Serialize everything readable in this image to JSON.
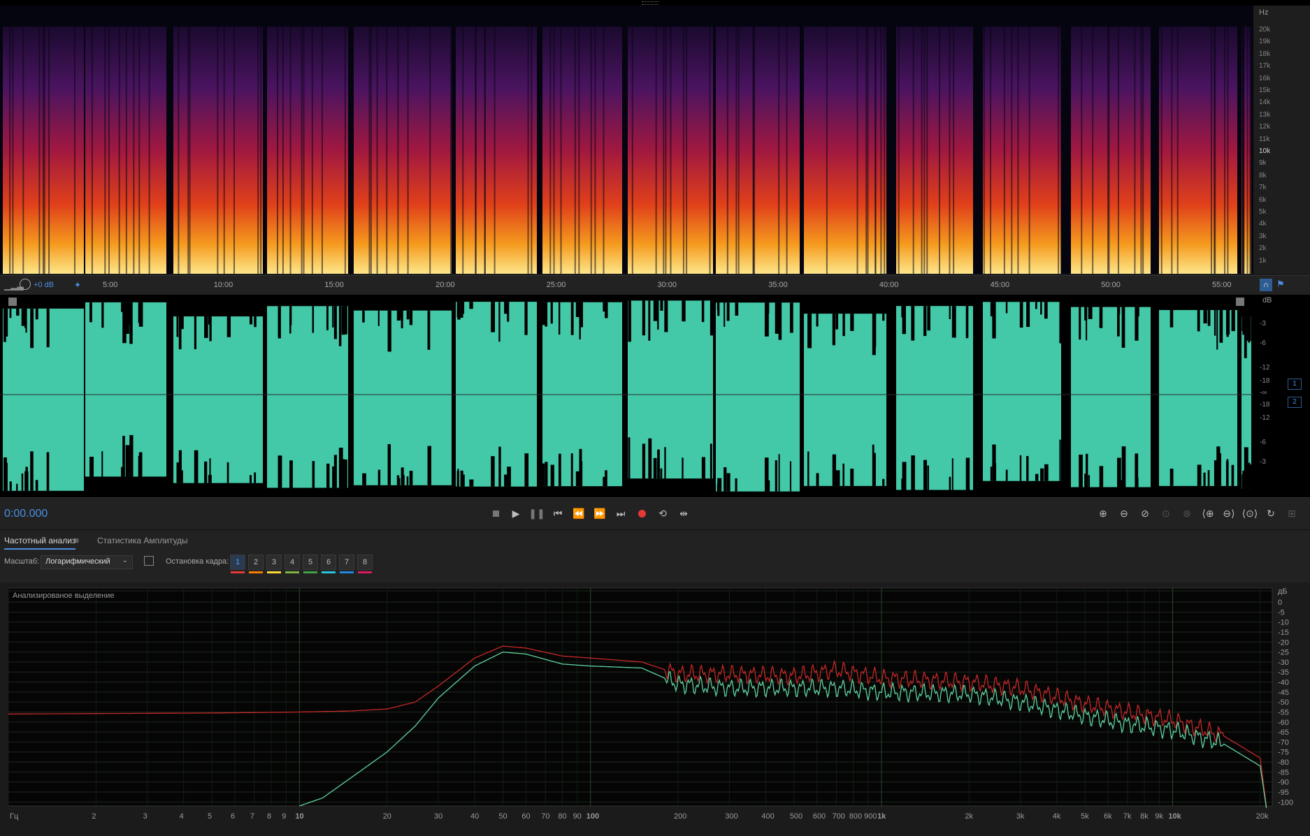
{
  "spectrogram": {
    "unit": "Hz",
    "ticks": [
      "20k",
      "19k",
      "18k",
      "17k",
      "16k",
      "15k",
      "14k",
      "13k",
      "12k",
      "11k",
      "10k",
      "9k",
      "8k",
      "7k",
      "6k",
      "5k",
      "4k",
      "3k",
      "2k",
      "1k"
    ]
  },
  "timeline": {
    "gain": "+0 dB",
    "labels": [
      "5:00",
      "10:00",
      "15:00",
      "20:00",
      "25:00",
      "30:00",
      "35:00",
      "40:00",
      "45:00",
      "50:00",
      "55:00"
    ]
  },
  "waveform": {
    "unit": "dB",
    "ticks_top": [
      "-3",
      "-6",
      "-12",
      "-18",
      "-∞"
    ],
    "ticks_bottom": [
      "-18",
      "-12",
      "-6",
      "-3"
    ],
    "channels": [
      "1",
      "2"
    ]
  },
  "transport": {
    "time": "0:00.000"
  },
  "panel": {
    "tabs": [
      "Частотный анализ",
      "Статистика Амплитуды"
    ],
    "scale_label": "Масштаб:",
    "scale_value": "Логарифмический",
    "freeze_label": "Остановка кадра:",
    "snapshots": [
      {
        "label": "1",
        "color": "#e53935"
      },
      {
        "label": "2",
        "color": "#f57c00"
      },
      {
        "label": "3",
        "color": "#fdd835"
      },
      {
        "label": "4",
        "color": "#7cb342"
      },
      {
        "label": "5",
        "color": "#43a047"
      },
      {
        "label": "6",
        "color": "#26c6da"
      },
      {
        "label": "7",
        "color": "#1e88e5"
      },
      {
        "label": "8",
        "color": "#d81b60"
      }
    ]
  },
  "chart_data": {
    "type": "line",
    "annotation": "Анализированое выделение",
    "xlabel": "Гц",
    "ylabel": "дБ",
    "x_scale": "log",
    "xlim": [
      1,
      22000
    ],
    "ylim": [
      -102,
      7
    ],
    "x_ticks": [
      {
        "v": 1,
        "t": "Гц"
      },
      {
        "v": 2,
        "t": "2"
      },
      {
        "v": 3,
        "t": "3"
      },
      {
        "v": 4,
        "t": "4"
      },
      {
        "v": 5,
        "t": "5"
      },
      {
        "v": 6,
        "t": "6"
      },
      {
        "v": 7,
        "t": "7"
      },
      {
        "v": 8,
        "t": "8"
      },
      {
        "v": 9,
        "t": "9"
      },
      {
        "v": 10,
        "t": "10"
      },
      {
        "v": 20,
        "t": "20"
      },
      {
        "v": 30,
        "t": "30"
      },
      {
        "v": 40,
        "t": "40"
      },
      {
        "v": 50,
        "t": "50"
      },
      {
        "v": 60,
        "t": "60"
      },
      {
        "v": 70,
        "t": "70"
      },
      {
        "v": 80,
        "t": "80"
      },
      {
        "v": 90,
        "t": "90"
      },
      {
        "v": 100,
        "t": "100"
      },
      {
        "v": 200,
        "t": "200"
      },
      {
        "v": 300,
        "t": "300"
      },
      {
        "v": 400,
        "t": "400"
      },
      {
        "v": 500,
        "t": "500"
      },
      {
        "v": 600,
        "t": "600"
      },
      {
        "v": 700,
        "t": "700"
      },
      {
        "v": 800,
        "t": "800"
      },
      {
        "v": 900,
        "t": "900"
      },
      {
        "v": 1000,
        "t": "1k"
      },
      {
        "v": 2000,
        "t": "2k"
      },
      {
        "v": 3000,
        "t": "3k"
      },
      {
        "v": 4000,
        "t": "4k"
      },
      {
        "v": 5000,
        "t": "5k"
      },
      {
        "v": 6000,
        "t": "6k"
      },
      {
        "v": 7000,
        "t": "7k"
      },
      {
        "v": 8000,
        "t": "8k"
      },
      {
        "v": 9000,
        "t": "9k"
      },
      {
        "v": 10000,
        "t": "10k"
      },
      {
        "v": 20000,
        "t": "20k"
      }
    ],
    "y_ticks": [
      "дБ",
      "0",
      "-5",
      "-10",
      "-15",
      "-20",
      "-25",
      "-30",
      "-35",
      "-40",
      "-45",
      "-50",
      "-55",
      "-60",
      "-65",
      "-70",
      "-75",
      "-80",
      "-85",
      "-90",
      "-95",
      "-100"
    ],
    "series": [
      {
        "color": "#c62828",
        "x": [
          1,
          5,
          10,
          15,
          20,
          25,
          30,
          40,
          50,
          60,
          80,
          100,
          150,
          200,
          300,
          500,
          700,
          1000,
          2000,
          3000,
          5000,
          7000,
          10000,
          15000,
          20000,
          21000
        ],
        "y": [
          -56,
          -55.5,
          -55,
          -54.5,
          -53.5,
          -50,
          -42,
          -28,
          -22,
          -23,
          -27,
          -28,
          -30,
          -36,
          -36,
          -37,
          -34,
          -38,
          -40,
          -43,
          -51,
          -55,
          -59,
          -67,
          -78,
          -102
        ]
      },
      {
        "color": "#5fd3a0",
        "x": [
          10,
          12,
          15,
          20,
          25,
          30,
          40,
          50,
          60,
          80,
          100,
          150,
          200,
          300,
          500,
          700,
          1000,
          2000,
          3000,
          5000,
          7000,
          10000,
          15000,
          20000,
          21000
        ],
        "y": [
          -102,
          -98,
          -88,
          -75,
          -62,
          -48,
          -32,
          -25,
          -26,
          -31,
          -32,
          -33,
          -41,
          -43,
          -43,
          -43,
          -45,
          -46,
          -50,
          -57,
          -61,
          -64,
          -71,
          -82,
          -103
        ]
      }
    ]
  }
}
